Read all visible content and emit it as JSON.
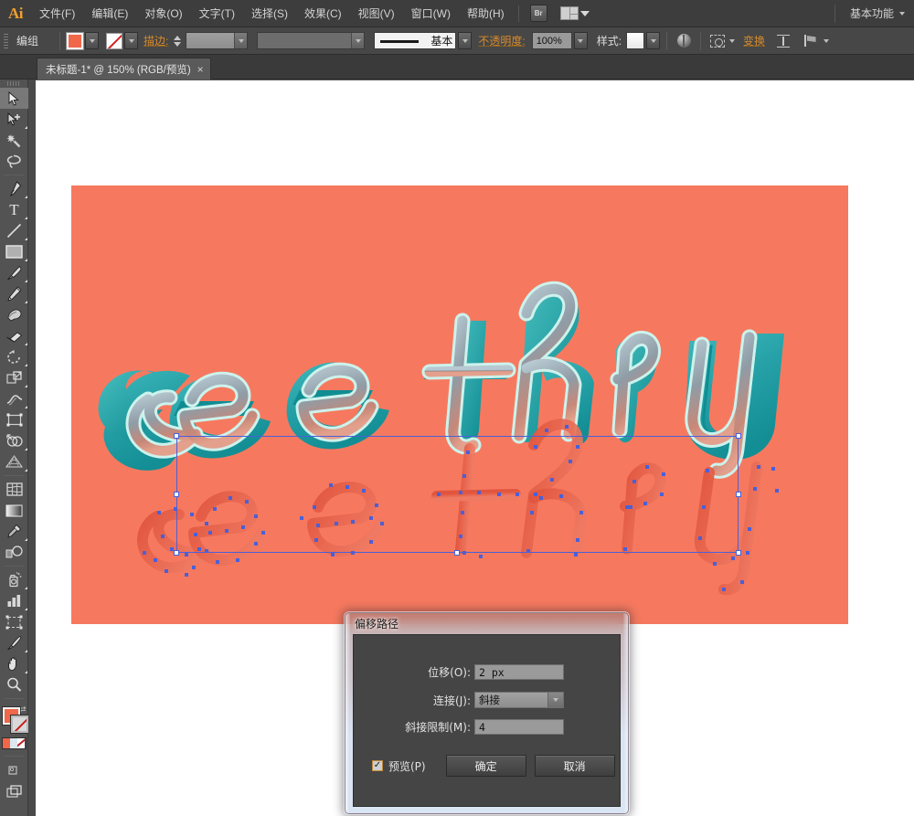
{
  "app": {
    "logo": "Ai",
    "workspace_label": "基本功能",
    "bridge_label": "Br"
  },
  "menu": {
    "items": [
      {
        "label": "文件(F)",
        "name": "menu-file"
      },
      {
        "label": "编辑(E)",
        "name": "menu-edit"
      },
      {
        "label": "对象(O)",
        "name": "menu-object"
      },
      {
        "label": "文字(T)",
        "name": "menu-type"
      },
      {
        "label": "选择(S)",
        "name": "menu-select"
      },
      {
        "label": "效果(C)",
        "name": "menu-effect"
      },
      {
        "label": "视图(V)",
        "name": "menu-view"
      },
      {
        "label": "窗口(W)",
        "name": "menu-window"
      },
      {
        "label": "帮助(H)",
        "name": "menu-help"
      }
    ]
  },
  "control_bar": {
    "selection_label": "编组",
    "fill_color": "#f0674a",
    "stroke_color": "none",
    "stroke_label": "描边:",
    "stroke_weight": "",
    "stroke_profile": "",
    "brush_label": "基本",
    "opacity_label": "不透明度:",
    "opacity_value": "100%",
    "style_label": "样式:",
    "transform_label": "变换"
  },
  "tab": {
    "title": "未标题-1* @ 150% (RGB/预览)",
    "close": "×"
  },
  "toolbar": {
    "groups": [
      [
        {
          "name": "selection-tool",
          "icon": "arrow-cursor",
          "selected": true,
          "flyout": false
        },
        {
          "name": "direct-selection-tool",
          "icon": "arrow-plus",
          "selected": false,
          "flyout": true
        },
        {
          "name": "magic-wand-tool",
          "icon": "magic-wand",
          "selected": false,
          "flyout": false
        },
        {
          "name": "lasso-tool",
          "icon": "lasso",
          "selected": false,
          "flyout": false
        }
      ],
      [
        {
          "name": "pen-tool",
          "icon": "pen-nib",
          "selected": false,
          "flyout": true
        },
        {
          "name": "type-tool",
          "icon": "type-T",
          "selected": false,
          "flyout": true
        },
        {
          "name": "line-segment-tool",
          "icon": "line-diagonal",
          "selected": false,
          "flyout": true
        },
        {
          "name": "rectangle-tool",
          "icon": "rectangle",
          "selected": false,
          "flyout": true
        },
        {
          "name": "paintbrush-tool",
          "icon": "paintbrush",
          "selected": false,
          "flyout": true
        },
        {
          "name": "pencil-tool",
          "icon": "pencil",
          "selected": false,
          "flyout": true
        },
        {
          "name": "blob-brush-tool",
          "icon": "blob-brush",
          "selected": false,
          "flyout": false
        },
        {
          "name": "eraser-tool",
          "icon": "eraser",
          "selected": false,
          "flyout": true
        },
        {
          "name": "rotate-tool",
          "icon": "rotate-arrow",
          "selected": false,
          "flyout": true
        },
        {
          "name": "scale-tool",
          "icon": "scale-box",
          "selected": false,
          "flyout": true
        },
        {
          "name": "width-tool",
          "icon": "width-warp",
          "selected": false,
          "flyout": true
        },
        {
          "name": "free-transform-tool",
          "icon": "free-transform",
          "selected": false,
          "flyout": false
        },
        {
          "name": "shape-builder-tool",
          "icon": "shape-builder",
          "selected": false,
          "flyout": true
        },
        {
          "name": "perspective-grid-tool",
          "icon": "perspective-grid",
          "selected": false,
          "flyout": true
        }
      ],
      [
        {
          "name": "mesh-tool",
          "icon": "mesh",
          "selected": false,
          "flyout": false
        },
        {
          "name": "gradient-tool",
          "icon": "gradient",
          "selected": false,
          "flyout": false
        },
        {
          "name": "eyedropper-tool",
          "icon": "eyedropper",
          "selected": false,
          "flyout": true
        },
        {
          "name": "blend-tool",
          "icon": "blend",
          "selected": false,
          "flyout": false
        }
      ],
      [
        {
          "name": "symbol-sprayer-tool",
          "icon": "symbol-sprayer",
          "selected": false,
          "flyout": true
        },
        {
          "name": "column-graph-tool",
          "icon": "bar-graph",
          "selected": false,
          "flyout": true
        },
        {
          "name": "artboard-tool",
          "icon": "artboard",
          "selected": false,
          "flyout": false
        },
        {
          "name": "slice-tool",
          "icon": "slice-knife",
          "selected": false,
          "flyout": true
        },
        {
          "name": "hand-tool",
          "icon": "hand",
          "selected": false,
          "flyout": true
        },
        {
          "name": "zoom-tool",
          "icon": "magnifier",
          "selected": false,
          "flyout": false
        }
      ]
    ],
    "fill_color": "#f0674a",
    "stroke_color": "none",
    "color_strip": [
      "#f0674a",
      "#dbe8ef",
      "none"
    ]
  },
  "artwork": {
    "background_color": "#f6795f",
    "text_line": "see thru",
    "extrude_color": "#2aa3aa",
    "highlight_color": "#bfeee8",
    "offset_preview_color": "#e85b46",
    "anchor_color": "#4a60d8"
  },
  "dialog": {
    "title": "偏移路径",
    "fields": [
      {
        "label": "位移(O):",
        "value": "2 px",
        "name": "offset-value-input"
      },
      {
        "label": "连接(J):",
        "value": "斜接",
        "name": "join-select"
      },
      {
        "label": "斜接限制(M):",
        "value": "4",
        "name": "miter-limit-input"
      }
    ],
    "preview_label": "预览(P)",
    "preview_checked": true,
    "checkmark": "✓",
    "ok_label": "确定",
    "cancel_label": "取消"
  }
}
